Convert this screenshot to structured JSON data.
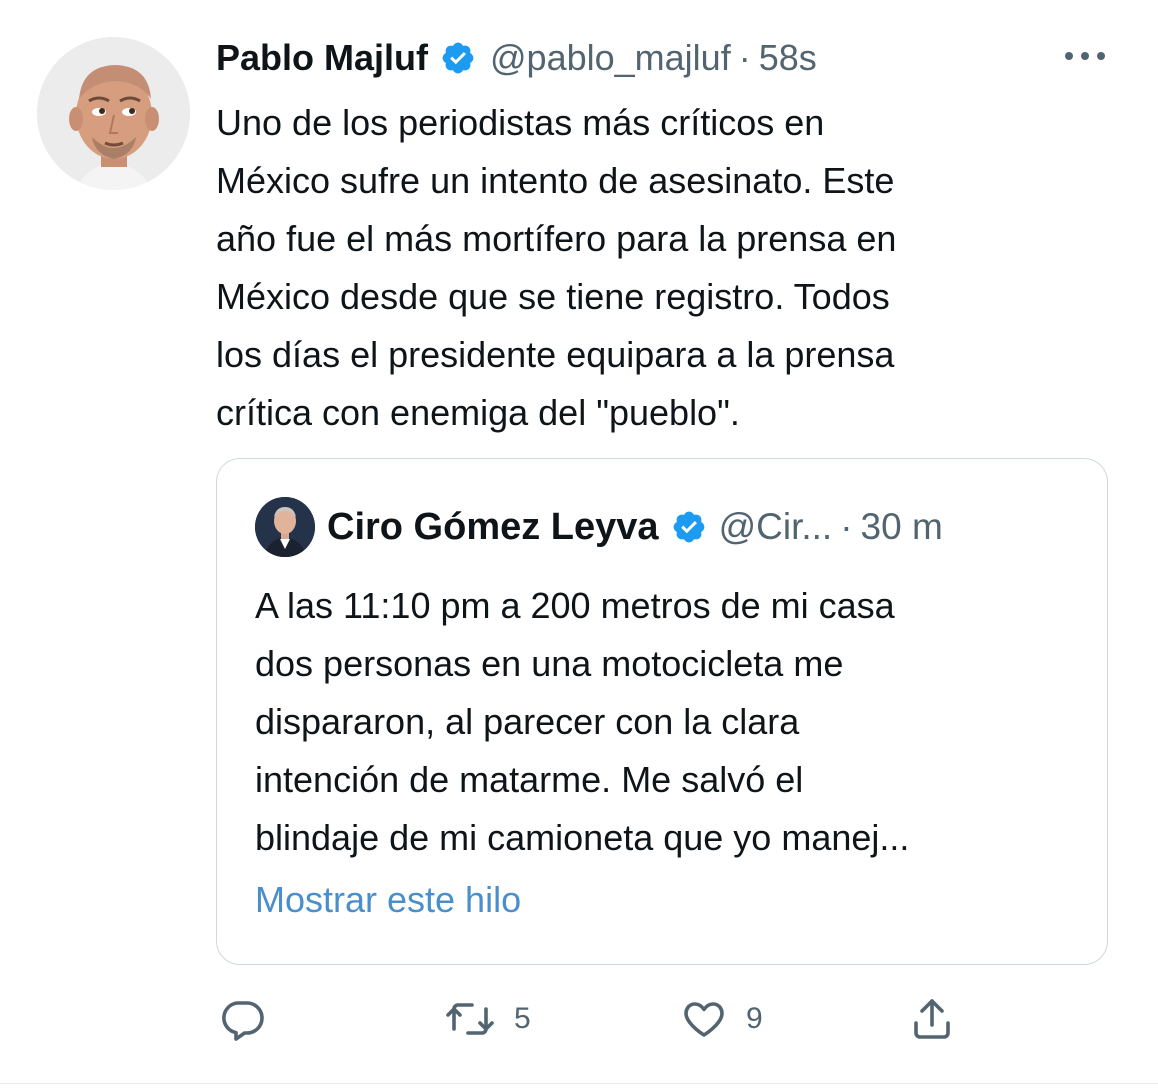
{
  "tweet": {
    "author_name": "Pablo Majluf",
    "handle": "@pablo_majluf",
    "separator": "·",
    "time": "58s",
    "verified_icon": "verified-badge-icon",
    "more_icon": "more-icon",
    "text_lines": [
      "Uno de los periodistas más críticos en",
      "México sufre un intento de asesinato. Este",
      "año fue el más mortífero para la prensa en",
      "México desde que se tiene registro. Todos",
      "los días el presidente equipara a la prensa",
      "crítica con enemiga del \"pueblo\"."
    ]
  },
  "quote": {
    "author_name": "Ciro Gómez Leyva",
    "handle": "@Cir...",
    "separator": "·",
    "time": "30 m",
    "text_lines": [
      "A las 11:10 pm a 200 metros de mi casa",
      "dos personas en una motocicleta me",
      "dispararon, al parecer con la clara",
      "intención de matarme. Me salvó el",
      "blindaje de mi camioneta que yo manej..."
    ],
    "show_thread": "Mostrar este hilo"
  },
  "actions": {
    "reply_icon": "reply-icon",
    "retweet_icon": "retweet-icon",
    "retweet_count": "5",
    "like_icon": "heart-icon",
    "like_count": "9",
    "share_icon": "share-icon"
  },
  "colors": {
    "text": "#0f1419",
    "secondary": "#536471",
    "link": "#4a8fcb",
    "verified": "#1d9bf0",
    "border": "#cfd9de"
  }
}
